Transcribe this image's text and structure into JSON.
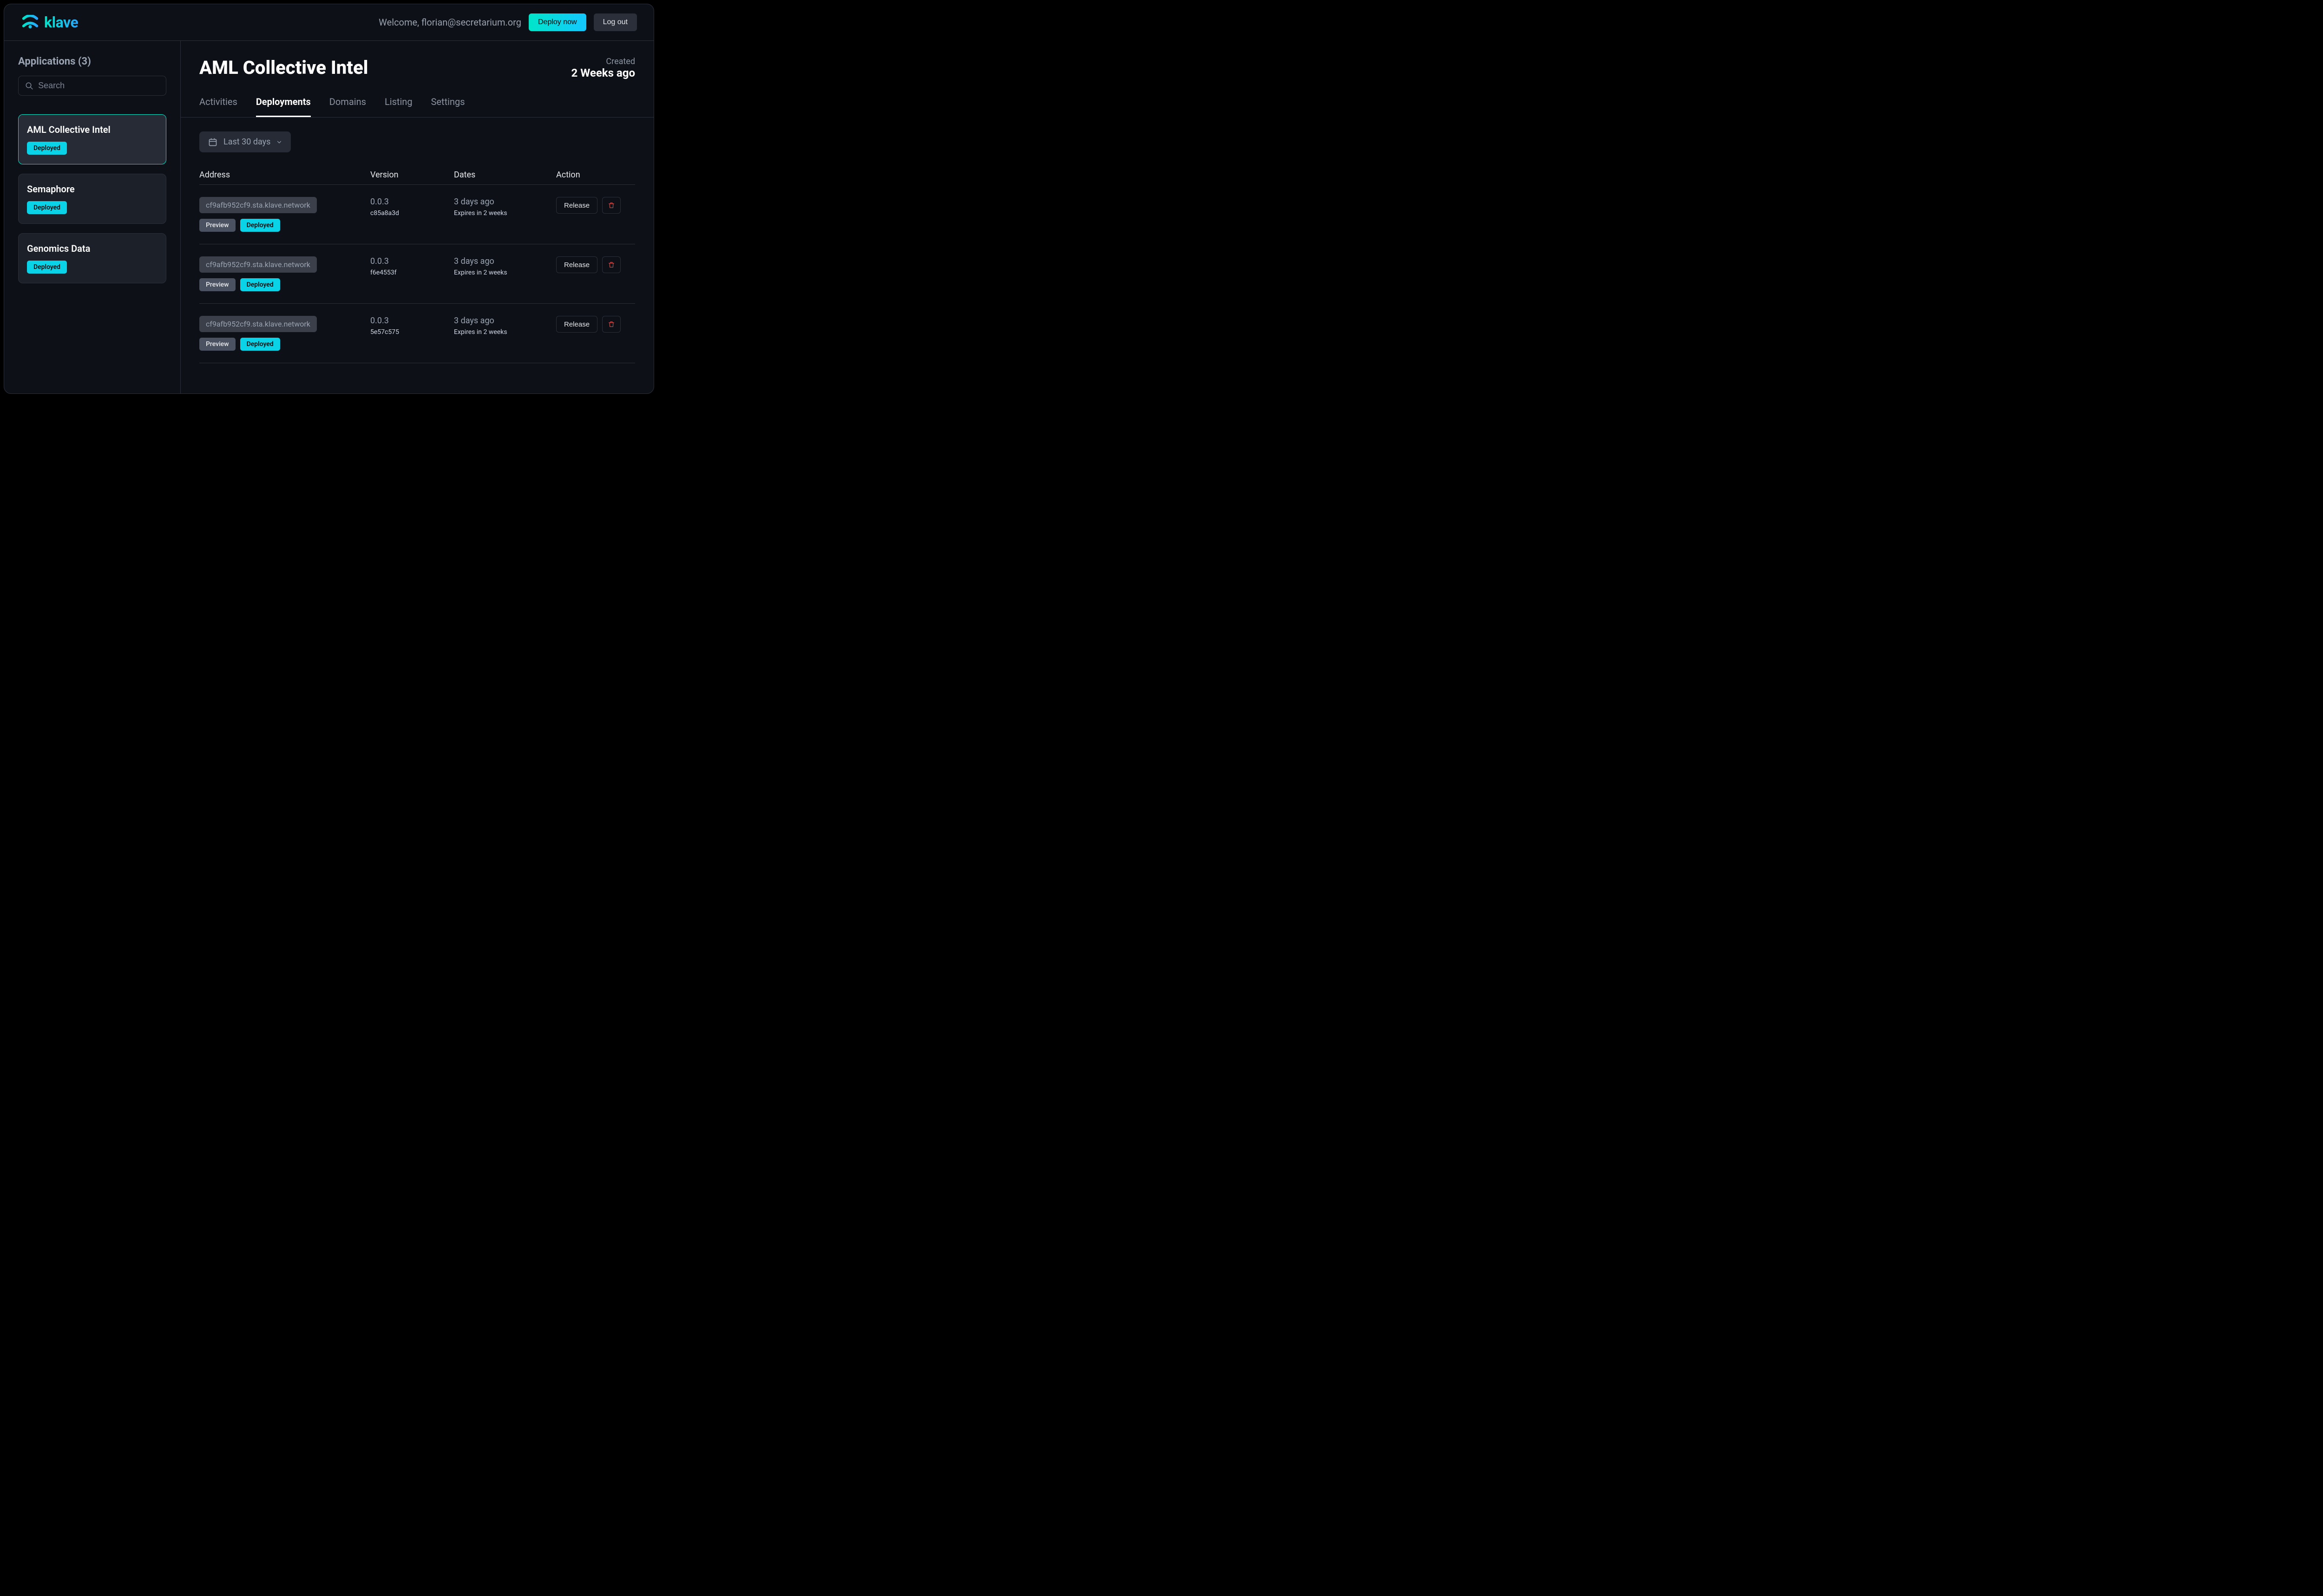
{
  "brand": {
    "name": "klave"
  },
  "header": {
    "welcome": "Welcome, florian@secretarium.org",
    "deploy_label": "Deploy now",
    "logout_label": "Log out"
  },
  "sidebar": {
    "title": "Applications (3)",
    "search_placeholder": "Search",
    "items": [
      {
        "name": "AML Collective Intel",
        "status": "Deployed",
        "active": true
      },
      {
        "name": "Semaphore",
        "status": "Deployed",
        "active": false
      },
      {
        "name": "Genomics Data",
        "status": "Deployed",
        "active": false
      }
    ]
  },
  "main": {
    "title": "AML Collective Intel",
    "created_label": "Created",
    "created_value": "2 Weeks ago",
    "tabs": [
      {
        "label": "Activities",
        "active": false
      },
      {
        "label": "Deployments",
        "active": true
      },
      {
        "label": "Domains",
        "active": false
      },
      {
        "label": "Listing",
        "active": false
      },
      {
        "label": "Settings",
        "active": false
      }
    ],
    "filter_label": "Last 30 days",
    "columns": {
      "address": "Address",
      "version": "Version",
      "dates": "Dates",
      "action": "Action"
    },
    "preview_label": "Preview",
    "deployed_label": "Deployed",
    "release_label": "Release",
    "rows": [
      {
        "address": "cf9afb952cf9.sta.klave.network",
        "version": "0.0.3",
        "hash": "c85a8a3d",
        "date": "3 days ago",
        "expires": "Expires in 2 weeks"
      },
      {
        "address": "cf9afb952cf9.sta.klave.network",
        "version": "0.0.3",
        "hash": "f6e4553f",
        "date": "3 days ago",
        "expires": "Expires in 2 weeks"
      },
      {
        "address": "cf9afb952cf9.sta.klave.network",
        "version": "0.0.3",
        "hash": "5e57c575",
        "date": "3 days ago",
        "expires": "Expires in 2 weeks"
      }
    ]
  }
}
